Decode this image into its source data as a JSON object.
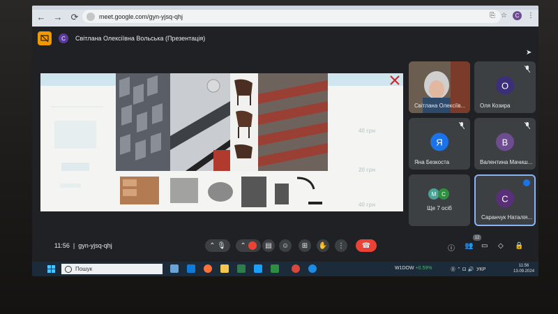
{
  "browser": {
    "url": "meet.google.com/gyn-yjsq-qhj",
    "profile_initial": "C"
  },
  "meet": {
    "presenter_initial": "С",
    "presenter_label": "Світлана Олексіївна Вольська (Презентація)",
    "participants": [
      {
        "name": "Світлана Олексіїв...",
        "initial": "",
        "avatar_color": "",
        "video": true
      },
      {
        "name": "Оля Козира",
        "initial": "O",
        "avatar_color": "#3b2f7a"
      },
      {
        "name": "Яна Безкоста",
        "initial": "Я",
        "avatar_color": "#1a73e8"
      },
      {
        "name": "Валентина Мачиш...",
        "initial": "B",
        "avatar_color": "#6d4c8f"
      },
      {
        "name": "Ще 7 осіб",
        "initial": "",
        "avatar_color": ""
      },
      {
        "name": "Саранчук Наталія...",
        "initial": "C",
        "avatar_color": "#5a2f7a"
      }
    ],
    "more_avatars": [
      "M",
      "C"
    ],
    "time": "11:56",
    "meeting_code": "gyn-yjsq-qhj",
    "participant_count": "12"
  },
  "slide": {
    "prices": [
      "40 грн",
      "20 грн",
      "40 грн"
    ]
  },
  "taskbar": {
    "search_placeholder": "Пошук",
    "stock_symbol": "W1DOW",
    "stock_change": "+0.59%",
    "language": "УКР",
    "clock_time": "11:56",
    "clock_date": "13.09.2024"
  },
  "colors": {
    "meet_bg": "#202124",
    "tile_bg": "#3c4043",
    "end_call": "#ea4335",
    "present_icon": "#f29900",
    "active_speaker": "#8ab4f8"
  }
}
